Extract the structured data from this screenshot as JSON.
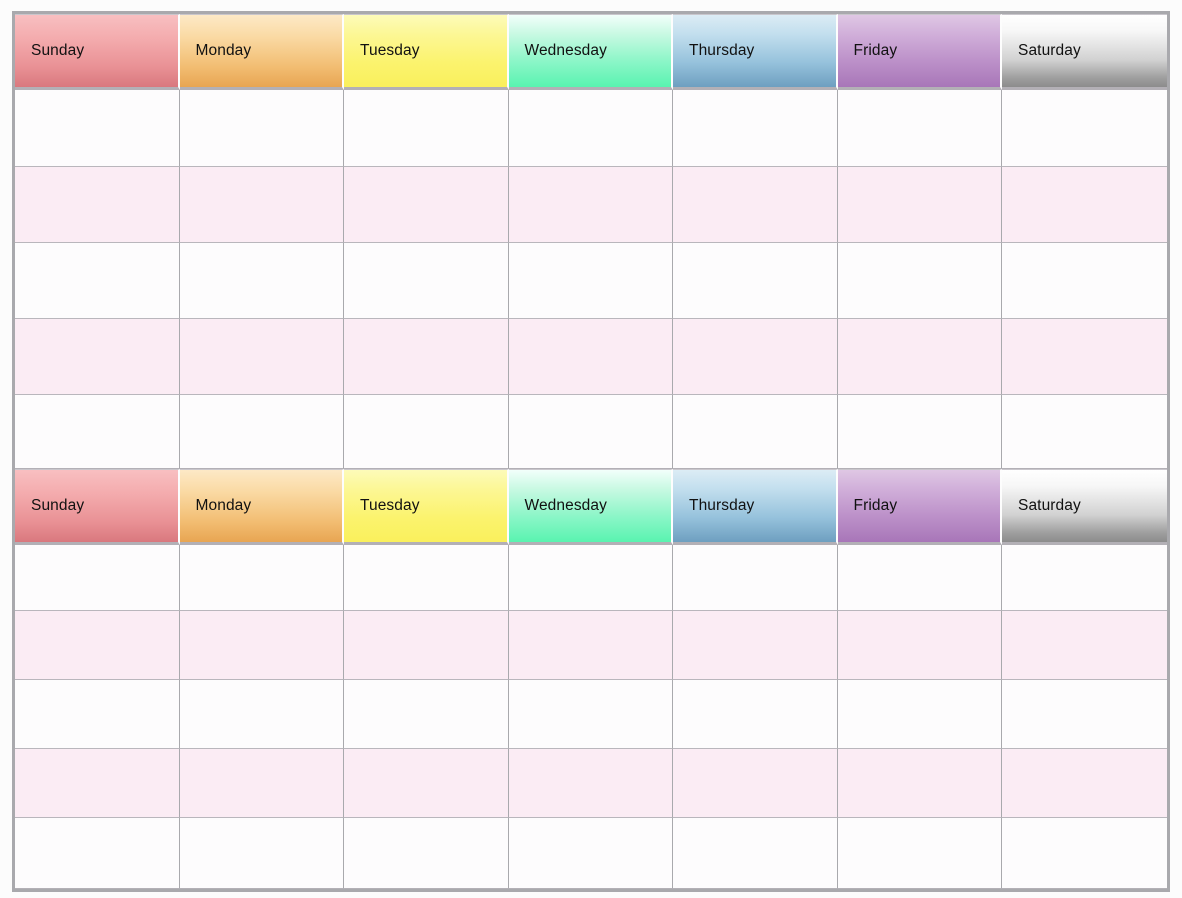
{
  "page": {
    "title": "Weekly Calendar Table",
    "background_color": "#fcfcfc",
    "table_border_color": "#a9a9ad"
  },
  "days": [
    {
      "label": "Sunday",
      "accent": "#d9787e",
      "key": "sunday"
    },
    {
      "label": "Monday",
      "accent": "#e8a552",
      "key": "monday"
    },
    {
      "label": "Tuesday",
      "accent": "#faf05c",
      "key": "tuesday"
    },
    {
      "label": "Wednesday",
      "accent": "#59f3b0",
      "key": "wednesday"
    },
    {
      "label": "Thursday",
      "accent": "#6e9fc0",
      "key": "thursday"
    },
    {
      "label": "Friday",
      "accent": "#a876b8",
      "key": "friday"
    },
    {
      "label": "Saturday",
      "accent": "#8c8c8c",
      "key": "saturday"
    }
  ],
  "blocks": [
    {
      "name": "week-block-1",
      "header": {
        "sunday": "Sunday",
        "monday": "Monday",
        "tuesday": "Tuesday",
        "wednesday": "Wednesday",
        "thursday": "Thursday",
        "friday": "Friday",
        "saturday": "Saturday"
      },
      "rows": [
        {
          "shade": "plain",
          "cells": [
            "",
            "",
            "",
            "",
            "",
            "",
            ""
          ]
        },
        {
          "shade": "tint",
          "cells": [
            "",
            "",
            "",
            "",
            "",
            "",
            ""
          ]
        },
        {
          "shade": "plain",
          "cells": [
            "",
            "",
            "",
            "",
            "",
            "",
            ""
          ]
        },
        {
          "shade": "tint",
          "cells": [
            "",
            "",
            "",
            "",
            "",
            "",
            ""
          ]
        },
        {
          "shade": "plain",
          "cells": [
            "",
            "",
            "",
            "",
            "",
            "",
            ""
          ]
        }
      ]
    },
    {
      "name": "week-block-2",
      "header": {
        "sunday": "Sunday",
        "monday": "Monday",
        "tuesday": "Tuesday",
        "wednesday": "Wednesday",
        "thursday": "Thursday",
        "friday": "Friday",
        "saturday": "Saturday"
      },
      "rows": [
        {
          "shade": "plain",
          "cells": [
            "",
            "",
            "",
            "",
            "",
            "",
            ""
          ]
        },
        {
          "shade": "tint",
          "cells": [
            "",
            "",
            "",
            "",
            "",
            "",
            ""
          ]
        },
        {
          "shade": "plain",
          "cells": [
            "",
            "",
            "",
            "",
            "",
            "",
            ""
          ]
        },
        {
          "shade": "tint",
          "cells": [
            "",
            "",
            "",
            "",
            "",
            "",
            ""
          ]
        },
        {
          "shade": "plain",
          "cells": [
            "",
            "",
            "",
            "",
            "",
            "",
            ""
          ]
        }
      ]
    }
  ],
  "styling": {
    "row_tint_color": "#fbecf4",
    "row_plain_color": "#fdfcfd",
    "header_text_color": "#111111"
  }
}
